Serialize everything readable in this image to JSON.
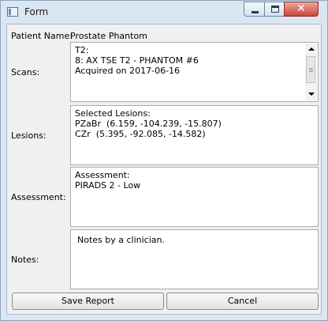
{
  "window": {
    "title": "Form",
    "icon": "form-window-icon"
  },
  "titlebar_buttons": {
    "minimize": "minimize-icon",
    "maximize": "maximize-icon",
    "close_glyph": "✕"
  },
  "patient": {
    "label": "Patient Name:",
    "value": "Prostate Phantom"
  },
  "scans": {
    "label": "Scans:",
    "text": "T2:\n8: AX TSE T2 - PHANTOM #6\nAcquired on 2017-06-16"
  },
  "lesions": {
    "label": "Lesions:",
    "text": "Selected Lesions:\nPZaBr  (6.159, -104.239, -15.807)\nCZr  (5.395, -92.085, -14.582)"
  },
  "assessment": {
    "label": "Assessment:",
    "text": "Assessment:\nPIRADS 2 - Low"
  },
  "notes": {
    "label": "Notes:",
    "text": "Notes by a clinician."
  },
  "buttons": {
    "save": "Save Report",
    "cancel": "Cancel"
  },
  "colors": {
    "frame": "#dbe6f3",
    "client": "#f0f0f0",
    "close_button": "#c9473a"
  }
}
